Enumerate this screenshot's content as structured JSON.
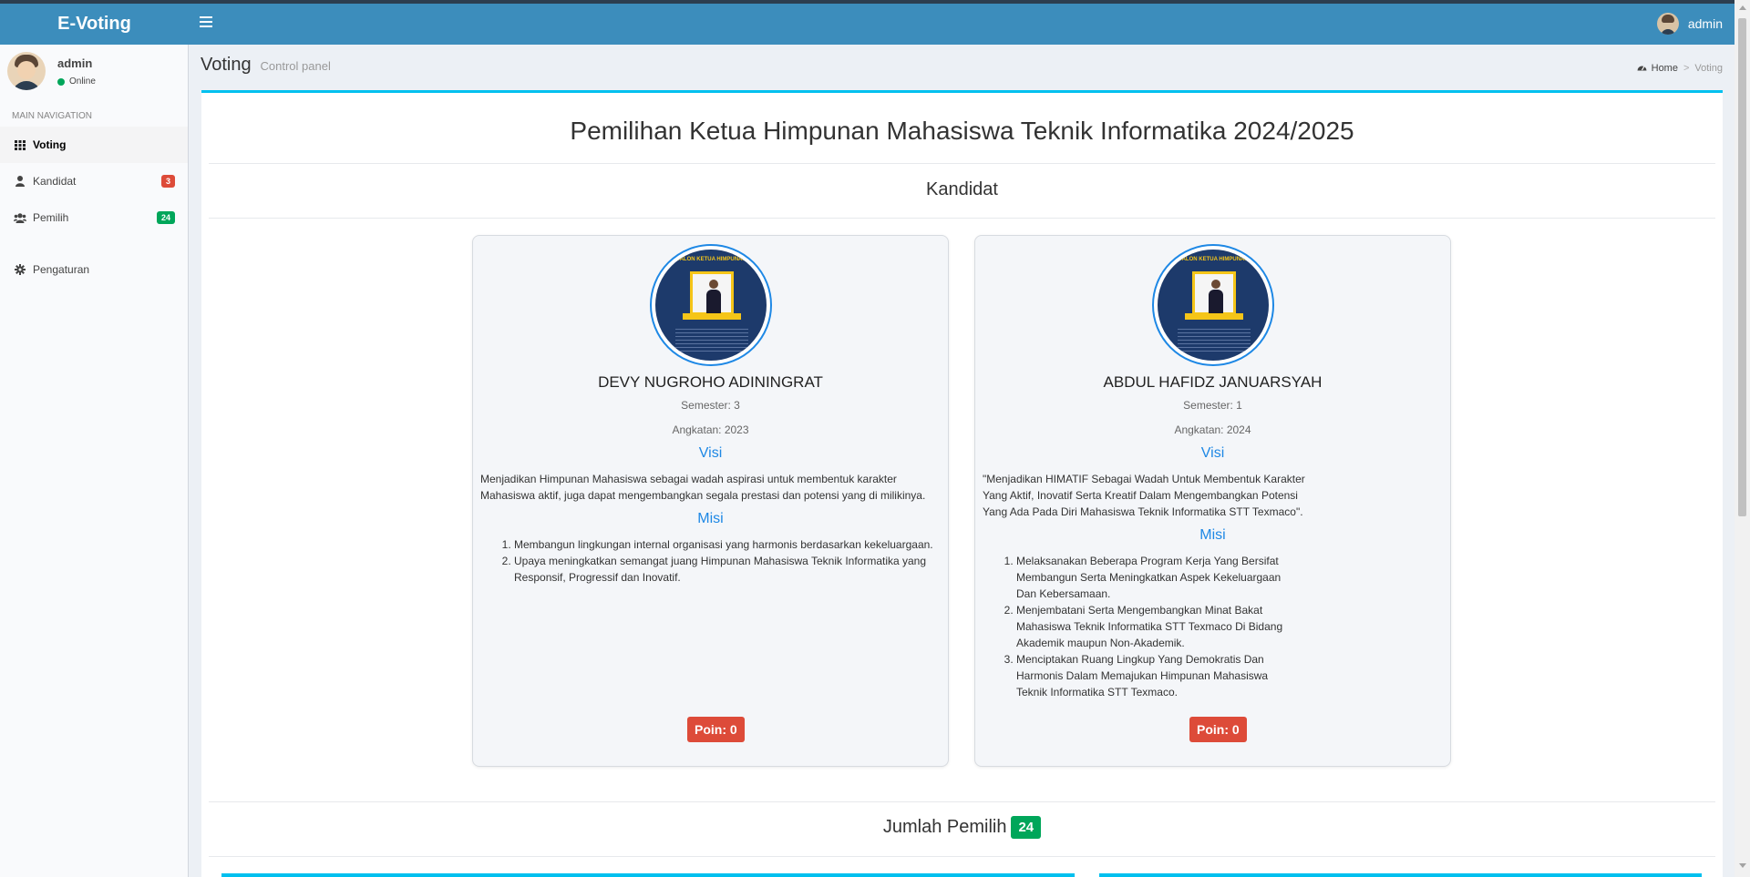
{
  "app": {
    "logo": "E-Voting",
    "user": "admin"
  },
  "sidebar": {
    "user_name": "admin",
    "status": "Online",
    "nav_header": "MAIN NAVIGATION",
    "items": [
      {
        "label": "Voting",
        "icon": "grid-icon"
      },
      {
        "label": "Kandidat",
        "icon": "user-icon",
        "badge": "3"
      },
      {
        "label": "Pemilih",
        "icon": "users-icon",
        "badge": "24"
      },
      {
        "label": "Pengaturan",
        "icon": "gear-icon"
      }
    ]
  },
  "header": {
    "title": "Voting",
    "subtitle": "Control panel",
    "breadcrumb": [
      "Home",
      "Voting"
    ]
  },
  "main": {
    "title": "Pemilihan Ketua Himpunan Mahasiswa Teknik Informatika 2024/2025",
    "candidates_heading": "Kandidat",
    "poster_text": "CALON KETUA HIMPUNAN",
    "visi_label": "Visi",
    "misi_label": "Misi",
    "candidates": [
      {
        "name": "DEVY NUGROHO ADININGRAT",
        "semester": "Semester: 3",
        "angkatan": "Angkatan: 2023",
        "visi": " Menjadikan Himpunan Mahasiswa sebagai wadah aspirasi untuk membentuk karakter Mahasiswa aktif, juga dapat mengembangkan segala prestasi dan potensi yang di milikinya.",
        "misi": [
          "Membangun lingkungan internal organisasi yang harmonis berdasarkan kekeluargaan.",
          "Upaya meningkatkan semangat juang Himpunan Mahasiswa Teknik Informatika yang Responsif, Progressif dan Inovatif."
        ],
        "poin": "Poin: 0"
      },
      {
        "name": "ABDUL HAFIDZ JANUARSYAH",
        "semester": "Semester: 1",
        "angkatan": "Angkatan: 2024",
        "visi": "\"Menjadikan HIMATIF Sebagai Wadah Untuk Membentuk Karakter Yang Aktif, Inovatif Serta Kreatif Dalam Mengembangkan Potensi Yang Ada Pada Diri Mahasiswa Teknik Informatika STT Texmaco\".",
        "misi": [
          "Melaksanakan Beberapa Program Kerja Yang Bersifat Membangun Serta Meningkatkan Aspek Kekeluargaan Dan Kebersamaan.",
          "Menjembatani Serta Mengembangkan Minat Bakat Mahasiswa Teknik Informatika STT Texmaco Di Bidang Akademik maupun Non-Akademik.",
          "Menciptakan Ruang Lingkup Yang Demokratis Dan Harmonis Dalam Memajukan Himpunan Mahasiswa Teknik Informatika STT Texmaco."
        ],
        "poin": "Poin: 0"
      }
    ],
    "voters_label": "Jumlah Pemilih",
    "voters_count": "24"
  },
  "colors": {
    "header": "#3c8dbc",
    "accent": "#00c0ef",
    "danger": "#dd4b39",
    "success": "#00a65a",
    "link": "#1e88e5"
  }
}
